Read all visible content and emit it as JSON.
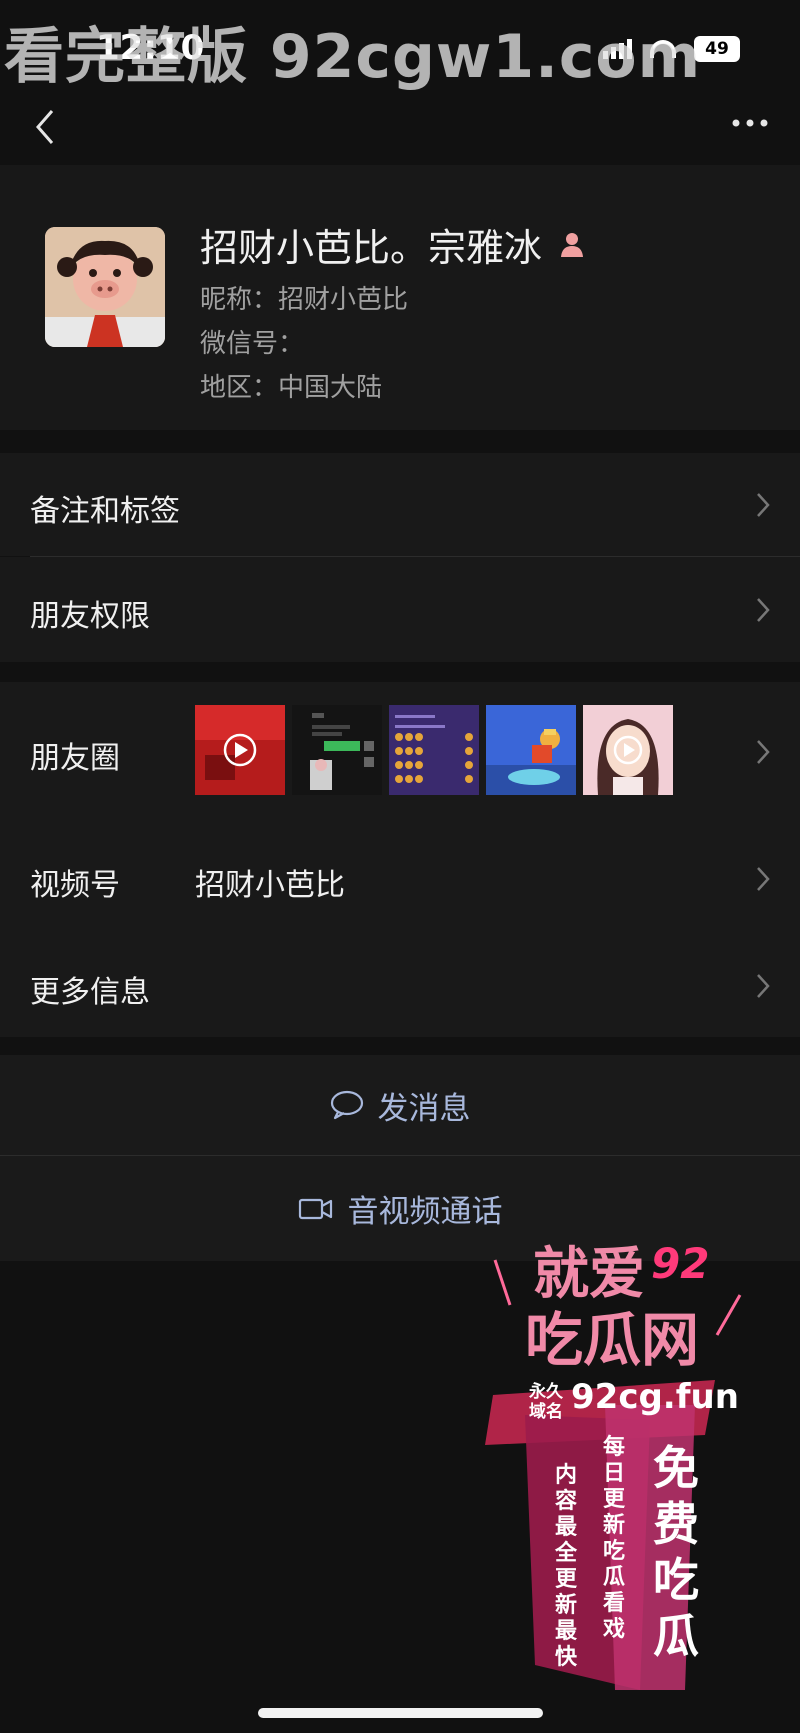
{
  "watermark_top": "看完整版 92cgw1.com",
  "status_bar": {
    "time": "12:10",
    "battery": "49"
  },
  "profile": {
    "name": "招财小芭比。宗雅冰",
    "nickname_line": "昵称：招财小芭比",
    "wechat_id_line": "微信号：",
    "region_line": "地区：中国大陆"
  },
  "menu": {
    "remarks": "备注和标签",
    "permissions": "朋友权限",
    "moments": "朋友圈",
    "channels": "视频号",
    "channels_value": "招财小芭比",
    "more_info": "更多信息"
  },
  "actions": {
    "send_message": "发消息",
    "av_call": "音视频通话"
  },
  "promo": {
    "line1": "就爱",
    "line1_badge": "92",
    "line2": "吃瓜网",
    "domain_prefix_1": "永久",
    "domain_prefix_2": "域名",
    "domain": "92cg.fun",
    "vertical_1": "免费吃瓜",
    "vertical_2": "每日更新 吃瓜看戏",
    "vertical_3": "内容最全 更新最快"
  },
  "colors": {
    "background": "#111111",
    "row_background": "#191919",
    "action_text": "#a8b8dc",
    "promo_pink": "#e0508a"
  }
}
